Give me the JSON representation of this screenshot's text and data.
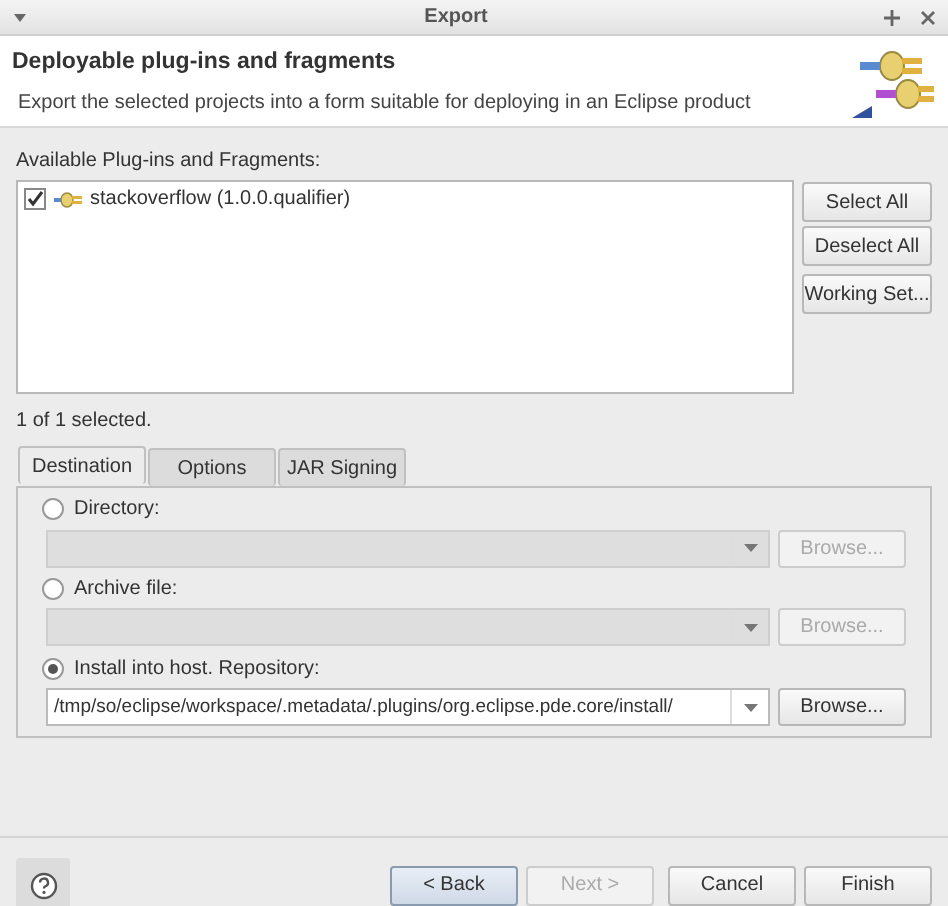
{
  "window": {
    "title": "Export"
  },
  "header": {
    "title": "Deployable plug-ins and fragments",
    "description": "Export the selected projects into a form suitable for deploying in an Eclipse product"
  },
  "plugins": {
    "label": "Available Plug-ins and Fragments:",
    "items": [
      {
        "label": "stackoverflow (1.0.0.qualifier)",
        "checked": true
      }
    ],
    "buttons": [
      "Select All",
      "Deselect All",
      "Working Set..."
    ],
    "status": "1 of 1 selected."
  },
  "tabs": [
    {
      "label": "Destination",
      "selected": true
    },
    {
      "label": "Options",
      "selected": false
    },
    {
      "label": "JAR Signing",
      "selected": false
    }
  ],
  "destinations": [
    {
      "label": "Directory:",
      "selected": false,
      "disabled": true,
      "browse": "Browse..."
    },
    {
      "label": "Archive file:",
      "selected": false,
      "disabled": true,
      "browse": "Browse..."
    },
    {
      "label": "Install into host. Repository:",
      "selected": true,
      "disabled": false,
      "value": "/tmp/so/eclipse/workspace/.metadata/.plugins/org.eclipse.pde.core/install/",
      "browse": "Browse..."
    }
  ],
  "footer": {
    "buttons": [
      {
        "label": "< Back",
        "disabled": false,
        "focused": true
      },
      {
        "label": "Next >",
        "disabled": true,
        "focused": false
      },
      {
        "label": "Cancel",
        "disabled": false,
        "focused": false
      },
      {
        "label": "Finish",
        "disabled": false,
        "focused": false
      }
    ]
  }
}
